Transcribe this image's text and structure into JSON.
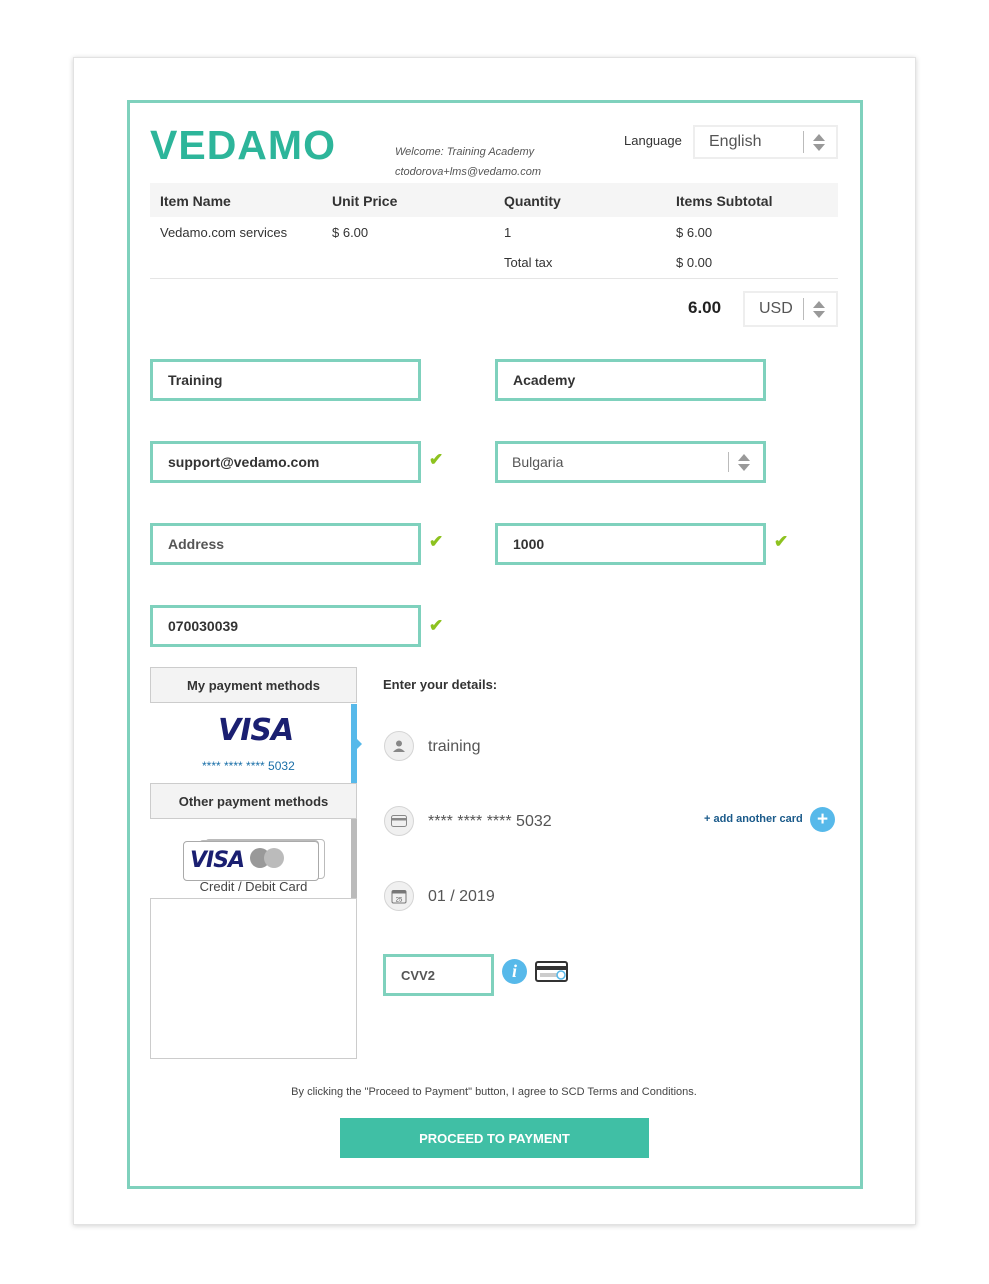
{
  "brand": {
    "logo_text": "VEDAMO",
    "accent_color": "#2db59a",
    "frame_color": "#7fd1bd"
  },
  "header": {
    "welcome": "Welcome: Training Academy",
    "email": "ctodorova+lms@vedamo.com",
    "language_label": "Language",
    "language_value": "English"
  },
  "order_table": {
    "headers": [
      "Item Name",
      "Unit Price",
      "Quantity",
      "Items Subtotal"
    ],
    "row": {
      "item": "Vedamo.com services",
      "unit_price": "$ 6.00",
      "quantity": "1",
      "subtotal": "$ 6.00"
    },
    "tax_label": "Total tax",
    "tax_value": "$ 0.00",
    "total": "6.00",
    "currency": "USD"
  },
  "form": {
    "first_name": "Training",
    "last_name": "Academy",
    "email": "support@vedamo.com",
    "country": "Bulgaria",
    "address_placeholder": "Address",
    "zip": "1000",
    "phone": "070030039",
    "check_mark": "✔"
  },
  "payment_methods": {
    "my_methods_title": "My payment methods",
    "saved_card_brand": "VISA",
    "saved_card_mask": "**** **** **** 5032",
    "other_methods_title": "Other payment methods",
    "other_card_brand": "VISA",
    "other_card_label": "Credit / Debit Card"
  },
  "details": {
    "title": "Enter your details:",
    "holder": "training",
    "card_number": "**** **** **** 5032",
    "add_card": "+ add another card",
    "expiry": "01 / 2019",
    "cvv_placeholder": "CVV2",
    "calendar_day": "25"
  },
  "footer": {
    "terms": "By clicking the \"Proceed to Payment\" button, I agree to SCD Terms and Conditions.",
    "proceed_button": "PROCEED TO PAYMENT"
  }
}
